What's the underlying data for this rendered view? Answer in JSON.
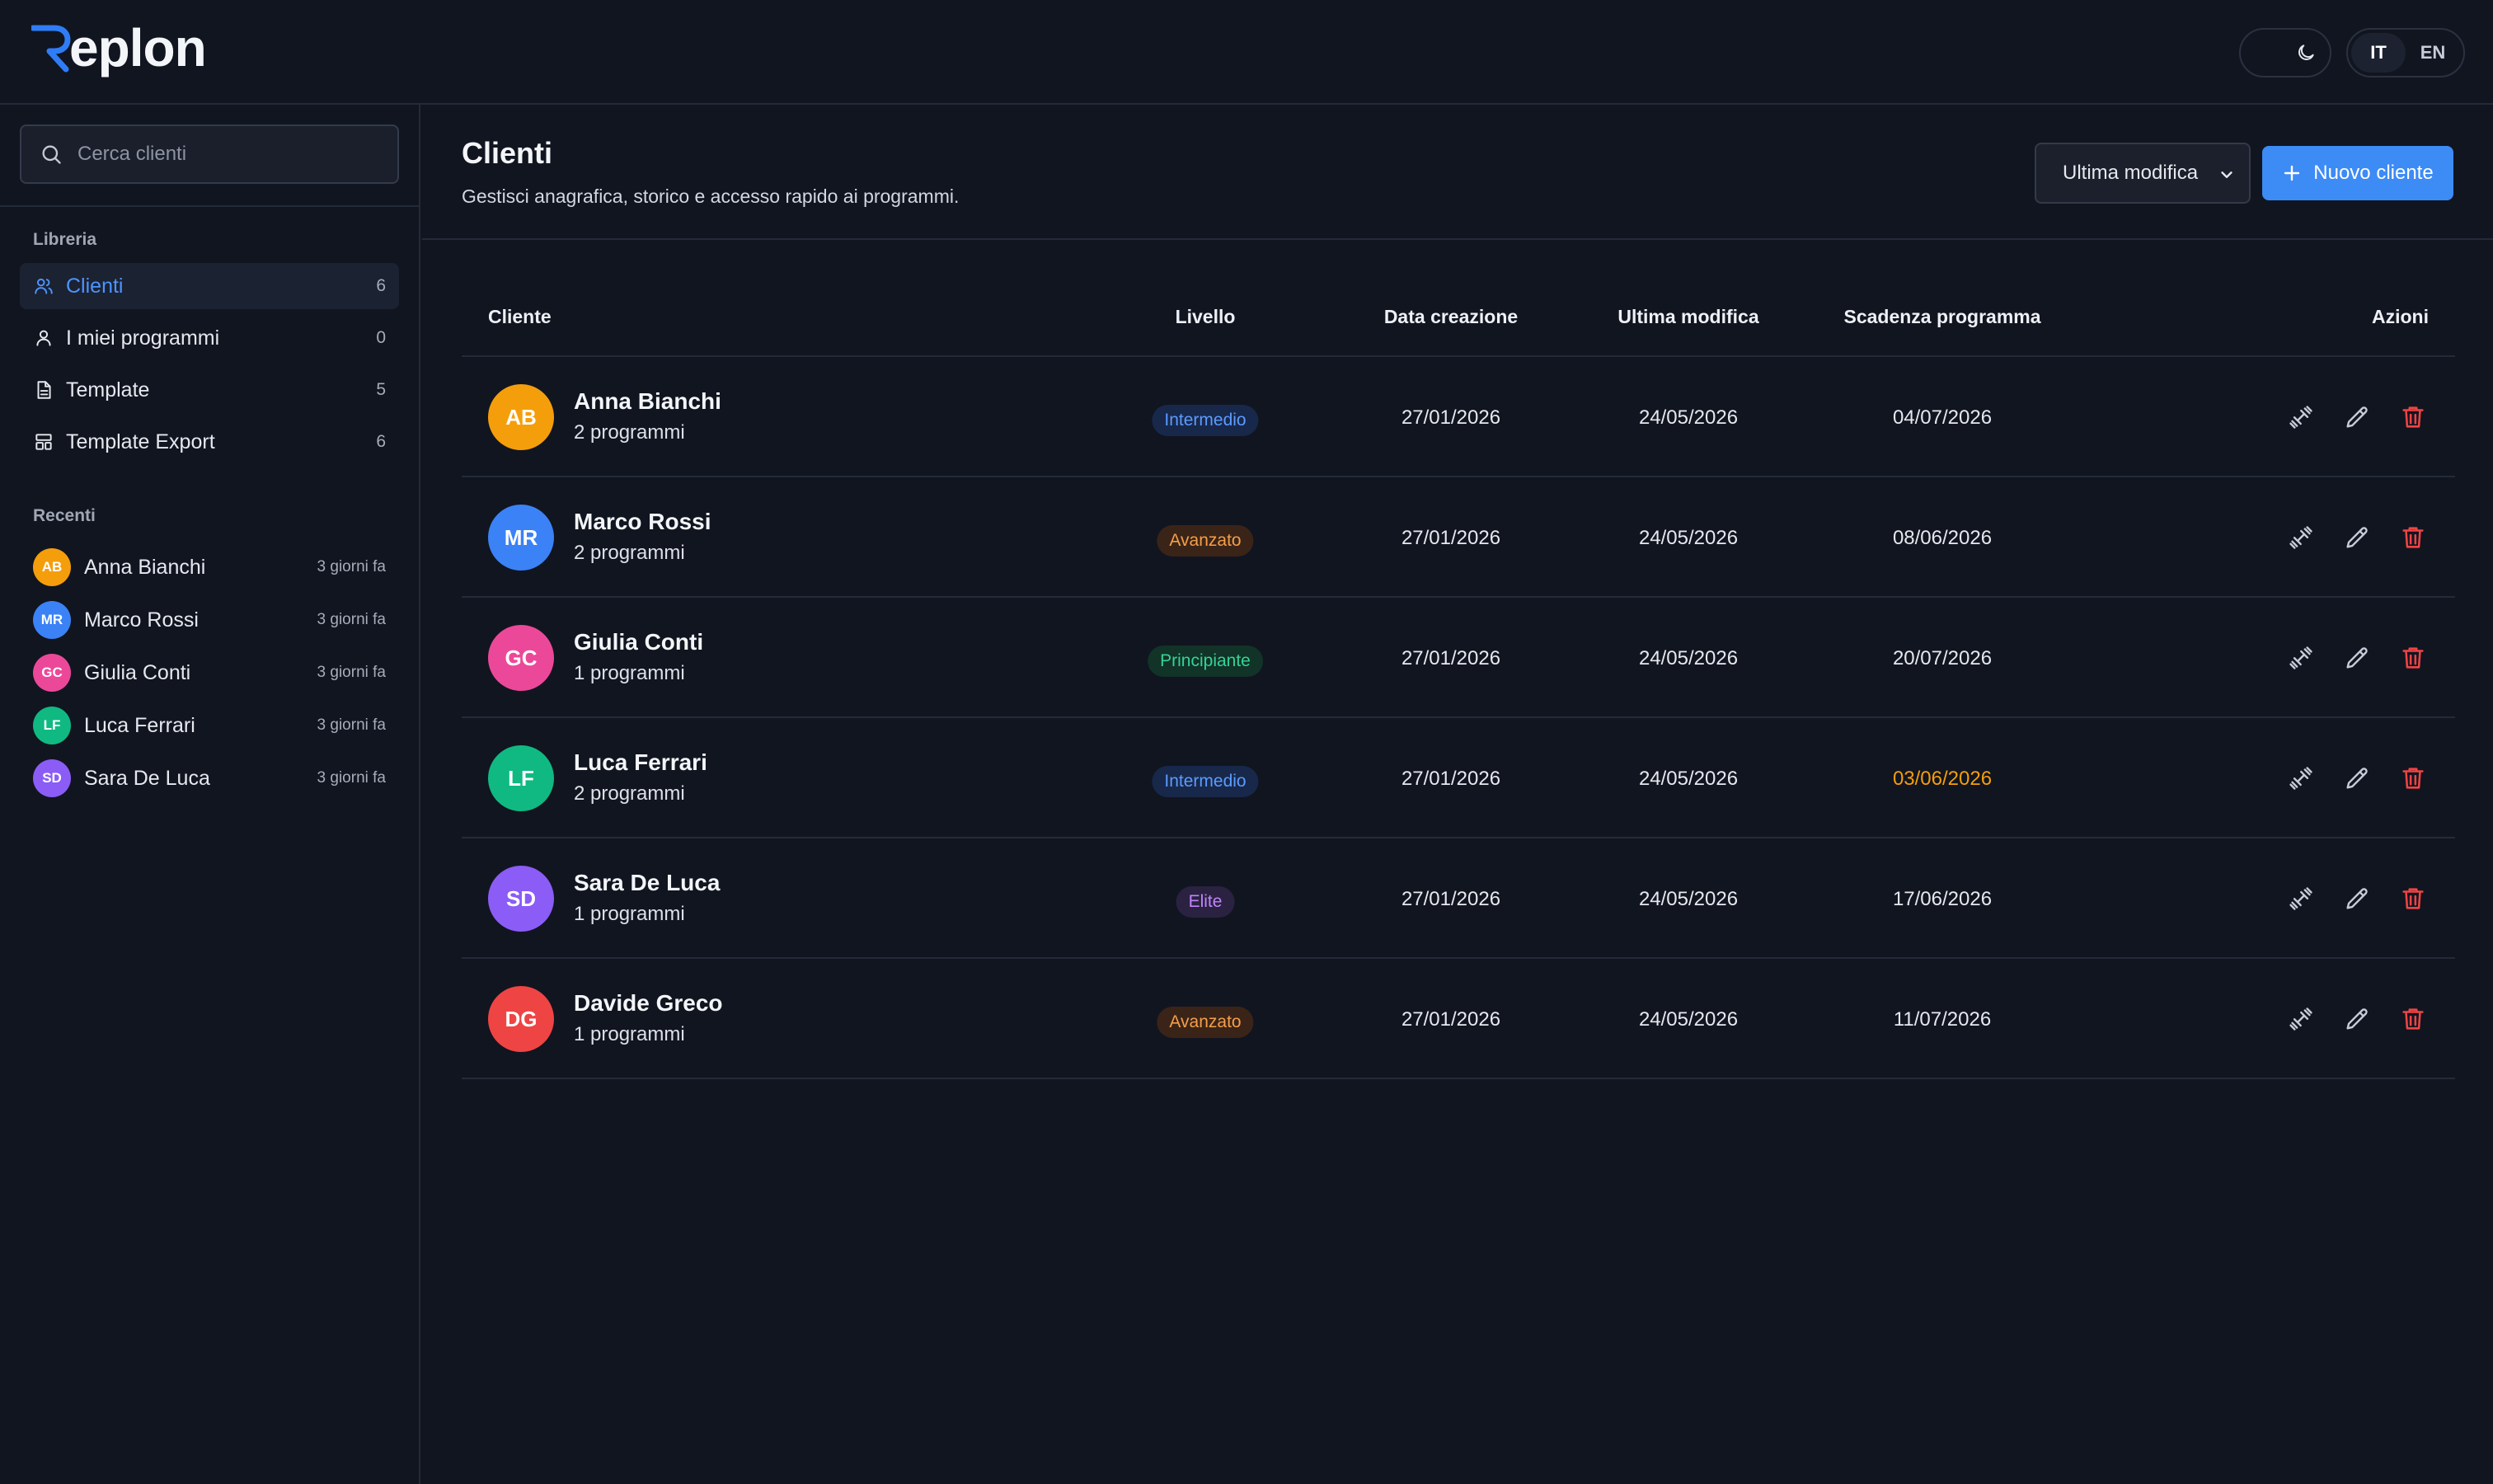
{
  "header": {
    "logo_text": "eplon",
    "lang_options": [
      "IT",
      "EN"
    ],
    "lang_active": "IT"
  },
  "sidebar": {
    "search_placeholder": "Cerca clienti",
    "library_label": "Libreria",
    "items": [
      {
        "label": "Clienti",
        "count": "6",
        "icon": "users-icon",
        "active": true
      },
      {
        "label": "I miei programmi",
        "count": "0",
        "icon": "user-icon",
        "active": false
      },
      {
        "label": "Template",
        "count": "5",
        "icon": "document-icon",
        "active": false
      },
      {
        "label": "Template Export",
        "count": "6",
        "icon": "layout-icon",
        "active": false
      }
    ],
    "recent_label": "Recenti",
    "recent": [
      {
        "initials": "AB",
        "name": "Anna Bianchi",
        "time": "3 giorni fa",
        "color": "#f59e0b"
      },
      {
        "initials": "MR",
        "name": "Marco Rossi",
        "time": "3 giorni fa",
        "color": "#3b82f6"
      },
      {
        "initials": "GC",
        "name": "Giulia Conti",
        "time": "3 giorni fa",
        "color": "#ec4899"
      },
      {
        "initials": "LF",
        "name": "Luca Ferrari",
        "time": "3 giorni fa",
        "color": "#10b981"
      },
      {
        "initials": "SD",
        "name": "Sara De Luca",
        "time": "3 giorni fa",
        "color": "#8b5cf6"
      }
    ]
  },
  "main": {
    "title": "Clienti",
    "subtitle": "Gestisci anagrafica, storico e accesso rapido ai programmi.",
    "sort_value": "Ultima modifica",
    "new_button": "Nuovo cliente",
    "columns": [
      "Cliente",
      "Livello",
      "Data creazione",
      "Ultima modifica",
      "Scadenza programma",
      "Azioni"
    ],
    "rows": [
      {
        "initials": "AB",
        "name": "Anna Bianchi",
        "programs": "2 programmi",
        "level": "Intermedio",
        "created": "27/01/2026",
        "modified": "24/05/2026",
        "expiry": "04/07/2026",
        "color": "#f59e0b",
        "expiry_warning": false
      },
      {
        "initials": "MR",
        "name": "Marco Rossi",
        "programs": "2 programmi",
        "level": "Avanzato",
        "created": "27/01/2026",
        "modified": "24/05/2026",
        "expiry": "08/06/2026",
        "color": "#3b82f6",
        "expiry_warning": false
      },
      {
        "initials": "GC",
        "name": "Giulia Conti",
        "programs": "1 programmi",
        "level": "Principiante",
        "created": "27/01/2026",
        "modified": "24/05/2026",
        "expiry": "20/07/2026",
        "color": "#ec4899",
        "expiry_warning": false
      },
      {
        "initials": "LF",
        "name": "Luca Ferrari",
        "programs": "2 programmi",
        "level": "Intermedio",
        "created": "27/01/2026",
        "modified": "24/05/2026",
        "expiry": "03/06/2026",
        "color": "#10b981",
        "expiry_warning": true
      },
      {
        "initials": "SD",
        "name": "Sara De Luca",
        "programs": "1 programmi",
        "level": "Elite",
        "created": "27/01/2026",
        "modified": "24/05/2026",
        "expiry": "17/06/2026",
        "color": "#8b5cf6",
        "expiry_warning": false
      },
      {
        "initials": "DG",
        "name": "Davide Greco",
        "programs": "1 programmi",
        "level": "Avanzato",
        "created": "27/01/2026",
        "modified": "24/05/2026",
        "expiry": "11/07/2026",
        "color": "#ef4444",
        "expiry_warning": false
      }
    ]
  },
  "level_styles": {
    "Intermedio": {
      "bg": "#18284a",
      "fg": "#5b9bff"
    },
    "Avanzato": {
      "bg": "#3a2418",
      "fg": "#f59e4a"
    },
    "Principiante": {
      "bg": "#123327",
      "fg": "#34d399"
    },
    "Elite": {
      "bg": "#2a2240",
      "fg": "#c084fc"
    }
  },
  "colors": {
    "accent": "#3d8bf5",
    "warning": "#f59e0b",
    "danger": "#ef4444"
  }
}
